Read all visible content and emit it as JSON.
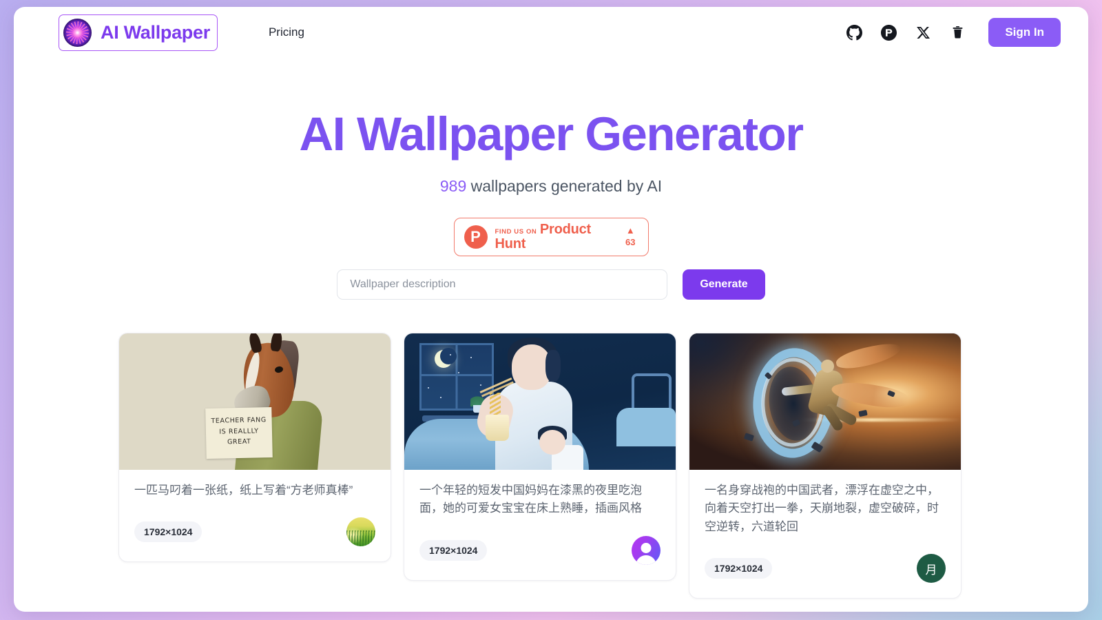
{
  "brand": {
    "name": "AI Wallpaper",
    "logo_icon": "mandala-logo-icon"
  },
  "nav": {
    "links": [
      {
        "label": "Pricing",
        "name": "pricing"
      }
    ],
    "social": [
      {
        "icon": "github-icon",
        "name": "github"
      },
      {
        "icon": "product-hunt-icon",
        "name": "product-hunt"
      },
      {
        "icon": "x-twitter-icon",
        "name": "x-twitter"
      },
      {
        "icon": "coffee-cup-icon",
        "name": "buy-me-a-coffee"
      }
    ],
    "signin_label": "Sign In"
  },
  "hero": {
    "title": "AI Wallpaper Generator",
    "count": "989",
    "subtitle_rest": " wallpapers generated by AI"
  },
  "product_hunt": {
    "find_us_on": "FIND US ON",
    "name": "Product Hunt",
    "arrow": "▲",
    "votes": "63",
    "accent_color": "#ef5f4c"
  },
  "search": {
    "placeholder": "Wallpaper description",
    "value": "",
    "generate_label": "Generate"
  },
  "colors": {
    "brand_purple": "#7c3aed",
    "title_purple": "#7b52f0",
    "button_purple": "#8b5cf6"
  },
  "cards": [
    {
      "caption": "一匹马叼着一张纸，纸上写着“方老师真棒”",
      "resolution": "1792×1024",
      "avatar_kind": "grass-photo-avatar",
      "avatar_text": "",
      "image_name": "horse-holding-sign-thumbnail",
      "sign_lines": [
        "TEACHER FANG",
        "IS  REALLLY",
        "GREAT"
      ]
    },
    {
      "caption": "一个年轻的短发中国妈妈在漆黑的夜里吃泡面，她的可爱女宝宝在床上熟睡，插画风格",
      "resolution": "1792×1024",
      "avatar_kind": "chat-bubble-avatar",
      "avatar_text": "",
      "image_name": "night-bedroom-mother-baby-thumbnail",
      "sign_lines": []
    },
    {
      "caption": "一名身穿战袍的中国武者，漂浮在虚空之中，向着天空打出一拳，天崩地裂，虚空破碎，时空逆转，六道轮回",
      "resolution": "1792×1024",
      "avatar_kind": "letter-avatar",
      "avatar_text": "月",
      "image_name": "warrior-vortex-thumbnail",
      "sign_lines": []
    }
  ]
}
